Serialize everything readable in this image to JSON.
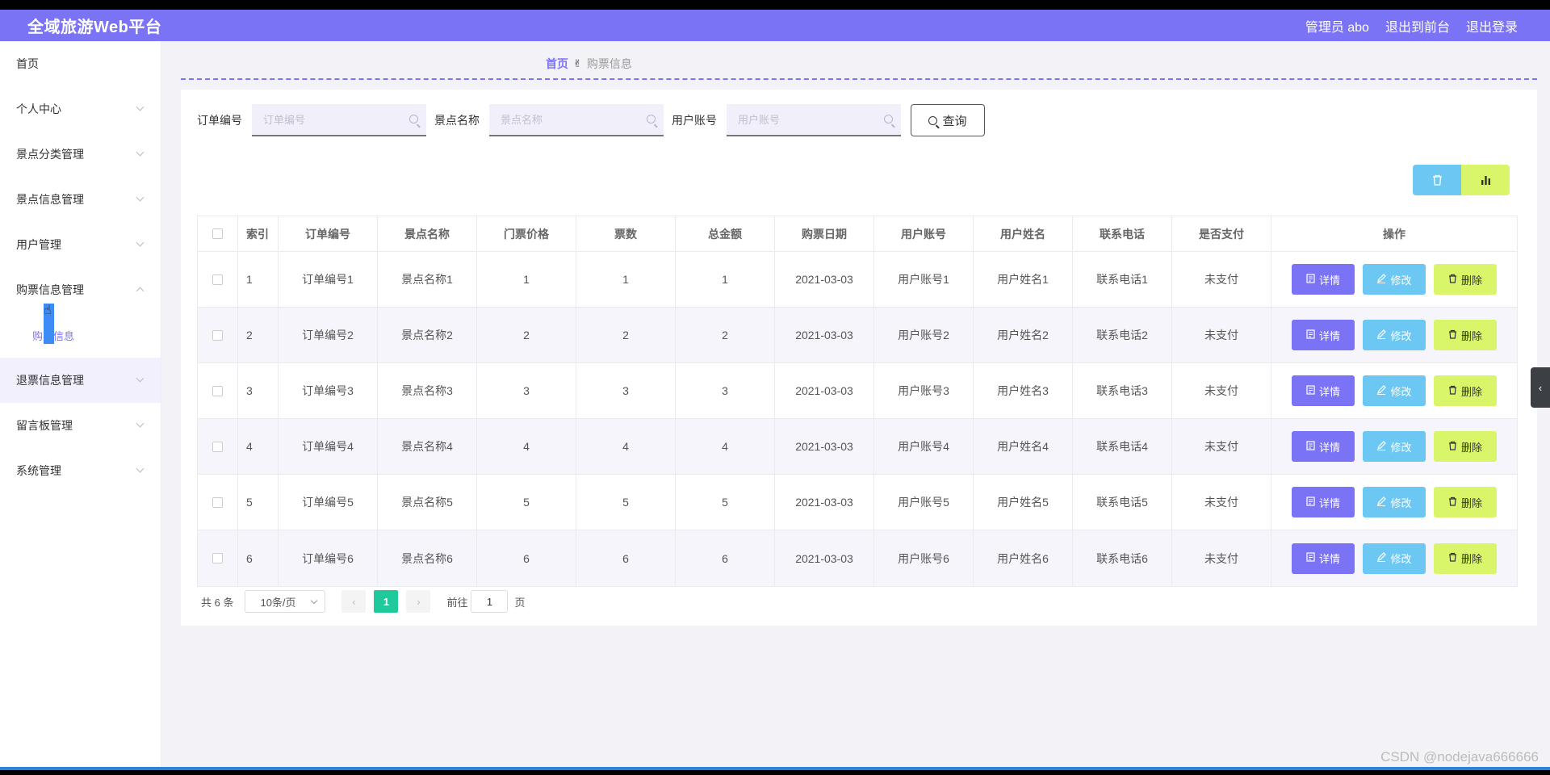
{
  "header": {
    "title": "全域旅游Web平台",
    "admin": "管理员 abo",
    "to_front": "退出到前台",
    "logout": "退出登录"
  },
  "sidebar": {
    "items": [
      {
        "label": "首页"
      },
      {
        "label": "个人中心"
      },
      {
        "label": "景点分类管理"
      },
      {
        "label": "景点信息管理"
      },
      {
        "label": "用户管理"
      },
      {
        "label": "购票信息管理"
      },
      {
        "label": "退票信息管理"
      },
      {
        "label": "留言板管理"
      },
      {
        "label": "系统管理"
      }
    ],
    "sub_item": "购票信息"
  },
  "breadcrumb": {
    "home": "首页",
    "separator": "✌",
    "current": "购票信息"
  },
  "search": {
    "order_label": "订单编号",
    "order_placeholder": "订单编号",
    "spot_label": "景点名称",
    "spot_placeholder": "景点名称",
    "user_label": "用户账号",
    "user_placeholder": "用户账号",
    "query_button": "查询"
  },
  "table": {
    "columns": [
      "索引",
      "订单编号",
      "景点名称",
      "门票价格",
      "票数",
      "总金额",
      "购票日期",
      "用户账号",
      "用户姓名",
      "联系电话",
      "是否支付",
      "操作"
    ],
    "rows": [
      [
        "1",
        "订单编号1",
        "景点名称1",
        "1",
        "1",
        "1",
        "2021-03-03",
        "用户账号1",
        "用户姓名1",
        "联系电话1",
        "未支付"
      ],
      [
        "2",
        "订单编号2",
        "景点名称2",
        "2",
        "2",
        "2",
        "2021-03-03",
        "用户账号2",
        "用户姓名2",
        "联系电话2",
        "未支付"
      ],
      [
        "3",
        "订单编号3",
        "景点名称3",
        "3",
        "3",
        "3",
        "2021-03-03",
        "用户账号3",
        "用户姓名3",
        "联系电话3",
        "未支付"
      ],
      [
        "4",
        "订单编号4",
        "景点名称4",
        "4",
        "4",
        "4",
        "2021-03-03",
        "用户账号4",
        "用户姓名4",
        "联系电话4",
        "未支付"
      ],
      [
        "5",
        "订单编号5",
        "景点名称5",
        "5",
        "5",
        "5",
        "2021-03-03",
        "用户账号5",
        "用户姓名5",
        "联系电话5",
        "未支付"
      ],
      [
        "6",
        "订单编号6",
        "景点名称6",
        "6",
        "6",
        "6",
        "2021-03-03",
        "用户账号6",
        "用户姓名6",
        "联系电话6",
        "未支付"
      ]
    ],
    "actions": {
      "detail": "详情",
      "edit": "修改",
      "delete": "删除"
    }
  },
  "pagination": {
    "total": "共 6 条",
    "page_size": "10条/页",
    "current_page": "1",
    "goto_label": "前往",
    "goto_value": "1",
    "page_suffix": "页"
  },
  "watermark": "CSDN @nodejava666666",
  "colors": {
    "primary": "#7b73f5",
    "edit": "#6cc8f3",
    "delete": "#d9f56a",
    "page_active": "#20c99b"
  }
}
